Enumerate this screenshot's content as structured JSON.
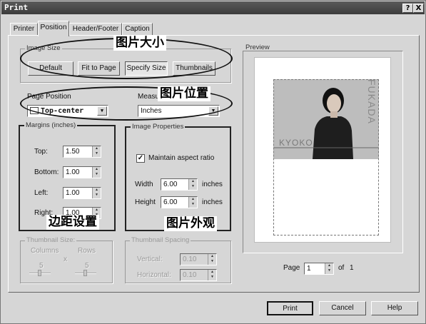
{
  "window": {
    "title": "Print"
  },
  "titlebar": {
    "help": "?",
    "close": "X"
  },
  "tabs": [
    "Printer",
    "Position",
    "Header/Footer",
    "Caption"
  ],
  "image_size": {
    "legend": "Image Size",
    "buttons": [
      "Default",
      "Fit to Page",
      "Specify Size",
      "Thumbnails"
    ],
    "selected": "Specify Size"
  },
  "page_position": {
    "label": "Page Position",
    "value": "Top-center"
  },
  "measure": {
    "label": "Measu",
    "value": "Inches"
  },
  "margins": {
    "legend": "Margins (inches)",
    "top_label": "Top:",
    "top": "1.50",
    "bottom_label": "Bottom:",
    "bottom": "1.00",
    "left_label": "Left:",
    "left": "1.00",
    "right_label": "Right:",
    "right": "1.00"
  },
  "image_props": {
    "legend": "Image Properties",
    "aspect_label": "Maintain aspect ratio",
    "aspect_checked": true,
    "width_label": "Width",
    "width": "6.00",
    "height_label": "Height",
    "height": "6.00",
    "unit": "inches"
  },
  "thumb_size": {
    "legend": "Thumbnail Size:",
    "columns_label": "Columns",
    "rows_label": "Rows",
    "x": "x",
    "columns": "5",
    "rows": "5"
  },
  "thumb_spacing": {
    "legend": "Thumbnail Spacing",
    "vertical_label": "Vertical:",
    "vertical": "0.10",
    "horizontal_label": "Horizontal:",
    "horizontal": "0.10"
  },
  "preview": {
    "legend": "Preview",
    "brand_vertical": "FUKADA",
    "brand_horizontal": "KYOKO",
    "page_label": "Page",
    "page": "1",
    "of": "of",
    "total": "1"
  },
  "annotations": {
    "image_size": "图片大小",
    "position": "图片位置",
    "margins": "边距设置",
    "appearance": "图片外观"
  },
  "footer": {
    "print": "Print",
    "cancel": "Cancel",
    "help": "Help"
  }
}
